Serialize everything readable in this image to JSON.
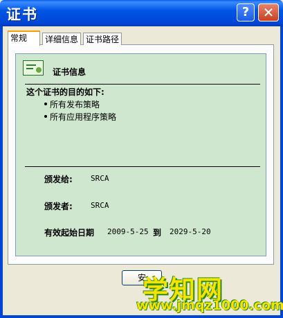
{
  "window": {
    "title": "证书",
    "help_glyph": "?",
    "close_glyph": "✕"
  },
  "tabs": [
    {
      "label": "常规",
      "active": true
    },
    {
      "label": "详细信息",
      "active": false
    },
    {
      "label": "证书路径",
      "active": false
    }
  ],
  "cert_info": {
    "heading": "证书信息",
    "purpose_intro": "这个证书的目的如下:",
    "purposes": [
      "所有发布策略",
      "所有应用程序策略"
    ],
    "issued_to_label": "颁发给:",
    "issued_to_value": "SRCA",
    "issued_by_label": "颁发者:",
    "issued_by_value": "SRCA",
    "validity_label": "有效起始日期",
    "valid_from": "2009-5-25",
    "to_label": "到",
    "valid_to": "2029-5-20"
  },
  "footer": {
    "button_label": "安"
  },
  "watermark": {
    "title": "学知网",
    "url": "www.jmqz1000.com"
  },
  "colors": {
    "titlebar": "#0055e5",
    "content_bg": "#cfe7cf",
    "active_tab_accent": "#ff9c00",
    "watermark_fill": "#f6e400",
    "watermark_outline": "#2e8b12"
  }
}
